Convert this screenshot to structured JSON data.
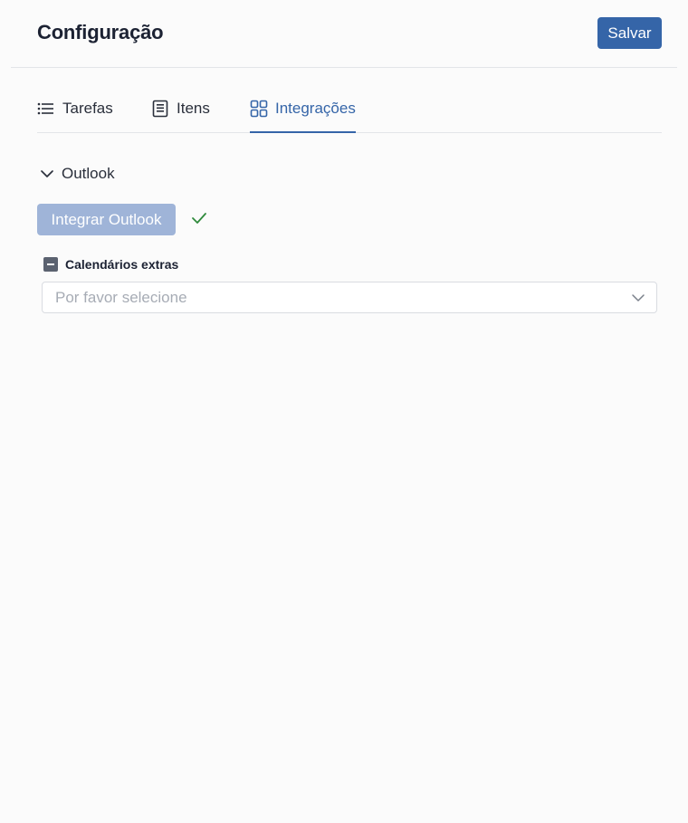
{
  "header": {
    "title": "Configuração",
    "save_label": "Salvar"
  },
  "tabs": [
    {
      "label": "Tarefas",
      "icon": "list-icon",
      "active": false
    },
    {
      "label": "Itens",
      "icon": "document-icon",
      "active": false
    },
    {
      "label": "Integrações",
      "icon": "grid-icon",
      "active": true
    }
  ],
  "outlook_section": {
    "title": "Outlook",
    "expanded": true,
    "integrate_button_label": "Integrar Outlook",
    "integrate_button_enabled": false,
    "integrated": true,
    "extra_calendars": {
      "label": "Calendários extras",
      "checkbox_state": "indeterminate",
      "placeholder": "Por favor selecione"
    }
  },
  "colors": {
    "accent": "#3565a8",
    "accent_disabled": "#9fb4d8",
    "success": "#2f8a3c",
    "background": "#fbfbfb"
  }
}
